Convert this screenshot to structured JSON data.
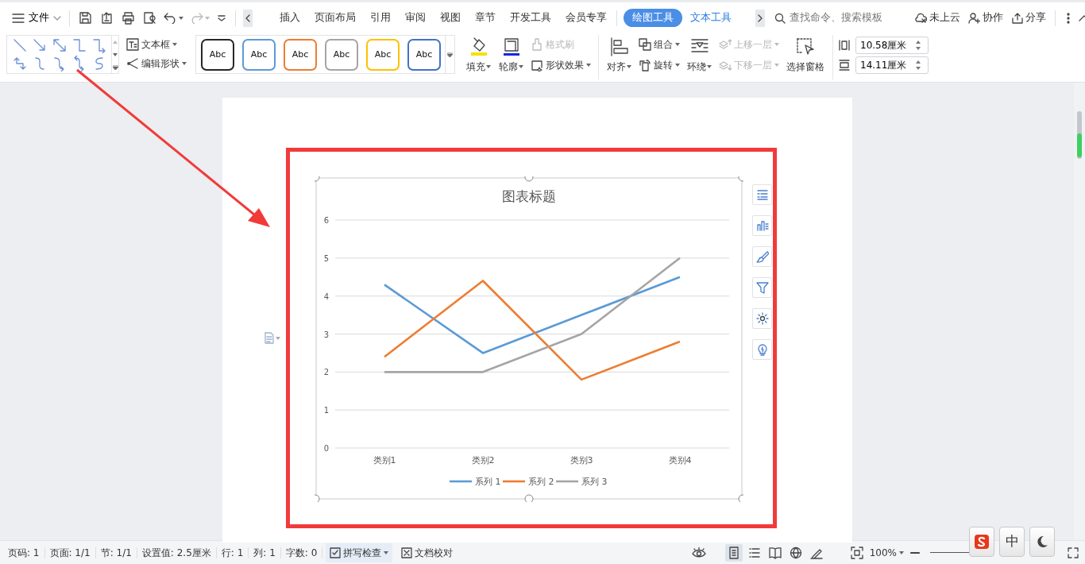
{
  "menu": {
    "label": "文件"
  },
  "tabs": [
    {
      "label": "插入",
      "selected": false,
      "kind": "standard"
    },
    {
      "label": "页面布局",
      "selected": false,
      "kind": "standard"
    },
    {
      "label": "引用",
      "selected": false,
      "kind": "standard"
    },
    {
      "label": "审阅",
      "selected": false,
      "kind": "standard"
    },
    {
      "label": "视图",
      "selected": false,
      "kind": "standard"
    },
    {
      "label": "章节",
      "selected": false,
      "kind": "standard"
    },
    {
      "label": "开发工具",
      "selected": false,
      "kind": "standard"
    },
    {
      "label": "会员专享",
      "selected": false,
      "kind": "standard"
    },
    {
      "label": "绘图工具",
      "selected": true,
      "kind": "contextual"
    },
    {
      "label": "文本工具",
      "selected": false,
      "kind": "contextual"
    }
  ],
  "search": {
    "placeholder": "查找命令、搜索模板"
  },
  "account_actions": [
    {
      "label": "未上云"
    },
    {
      "label": "协作"
    },
    {
      "label": "分享"
    }
  ],
  "ribbon": {
    "text_tools": [
      {
        "label": "文本框"
      },
      {
        "label": "编辑形状"
      }
    ],
    "shape_styles": [
      {
        "label": "Abc",
        "color": "#262626"
      },
      {
        "label": "Abc",
        "color": "#5b9bd5"
      },
      {
        "label": "Abc",
        "color": "#ed7d31"
      },
      {
        "label": "Abc",
        "color": "#a5a5a5"
      },
      {
        "label": "Abc",
        "color": "#ffc000"
      },
      {
        "label": "Abc",
        "color": "#4472c4"
      }
    ],
    "format_tools": [
      {
        "label": "填充",
        "kind": "large",
        "dropdown": true,
        "disabled": false
      },
      {
        "label": "轮廓",
        "kind": "large",
        "dropdown": true,
        "disabled": false
      },
      {
        "label": "格式刷",
        "kind": "small",
        "dropdown": false,
        "disabled": true
      },
      {
        "label": "形状效果",
        "kind": "small",
        "dropdown": true,
        "disabled": false
      }
    ],
    "arrange_tools": [
      {
        "label": "对齐",
        "kind": "large",
        "dropdown": true,
        "disabled": false
      },
      {
        "label": "组合",
        "kind": "small",
        "dropdown": true,
        "disabled": false
      },
      {
        "label": "旋转",
        "kind": "small",
        "dropdown": true,
        "disabled": false
      },
      {
        "label": "环绕",
        "kind": "large",
        "dropdown": true,
        "disabled": false
      },
      {
        "label": "上移一层",
        "kind": "small",
        "dropdown": true,
        "disabled": true
      },
      {
        "label": "下移一层",
        "kind": "small",
        "dropdown": true,
        "disabled": true
      },
      {
        "label": "选择窗格",
        "kind": "large",
        "dropdown": false,
        "disabled": false
      }
    ],
    "size_fields": [
      {
        "value": "10.58厘米"
      },
      {
        "value": "14.11厘米"
      }
    ]
  },
  "chart": {
    "chart_data": {
      "type": "line",
      "title": "图表标题",
      "categories": [
        "类别1",
        "类别2",
        "类别3",
        "类别4"
      ],
      "series": [
        {
          "name": "系列 1",
          "color": "#5b9bd5",
          "values": [
            4.3,
            2.5,
            3.5,
            4.5
          ]
        },
        {
          "name": "系列 2",
          "color": "#ed7d31",
          "values": [
            2.4,
            4.4,
            1.8,
            2.8
          ]
        },
        {
          "name": "系列 3",
          "color": "#a5a5a5",
          "values": [
            2,
            2,
            3,
            5
          ]
        }
      ],
      "ylim": [
        0,
        6
      ],
      "yticks": [
        0,
        1,
        2,
        3,
        4,
        5,
        6
      ],
      "grid": true,
      "legend": "bottom"
    }
  },
  "status_bar": {
    "items": [
      "页码: 1",
      "页面: 1/1",
      "节: 1/1",
      "设置值: 2.5厘米",
      "行: 1",
      "列: 1",
      "字数: 0"
    ],
    "spell_check": "拼写检查",
    "proofread": "文档校对",
    "zoom": "100%"
  },
  "ime": {
    "mode": "中"
  }
}
